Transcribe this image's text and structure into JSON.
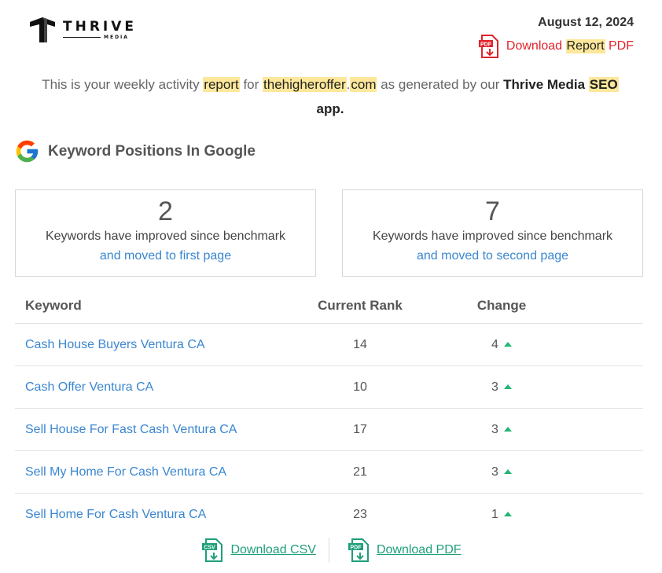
{
  "brand": {
    "name": "THRIVE",
    "sub": "MEDIA"
  },
  "header": {
    "date": "August 12, 2024",
    "download_report": {
      "prefix": "Download ",
      "highlight": "Report",
      "suffix": " PDF"
    }
  },
  "intro": {
    "t1": "This is your weekly activity ",
    "h1": "report",
    "t2": " for ",
    "h2a": "thehigheroffer",
    "dot": ".",
    "h2b": "com",
    "t3": " as generated by our ",
    "b1": "Thrive Media ",
    "h3": "SEO",
    "b2": "app."
  },
  "section": {
    "title": "Keyword Positions In Google"
  },
  "cards": [
    {
      "count": "2",
      "line1": "Keywords have improved since benchmark",
      "line2": "and moved to first page"
    },
    {
      "count": "7",
      "line1": "Keywords have improved since benchmark",
      "line2": "and moved to second page"
    }
  ],
  "table": {
    "headers": {
      "keyword": "Keyword",
      "rank": "Current Rank",
      "change": "Change"
    },
    "rows": [
      {
        "keyword": "Cash House Buyers Ventura CA",
        "rank": "14",
        "change": "4"
      },
      {
        "keyword": "Cash Offer Ventura CA",
        "rank": "10",
        "change": "3"
      },
      {
        "keyword": "Sell House For Fast Cash Ventura CA",
        "rank": "17",
        "change": "3"
      },
      {
        "keyword": "Sell My Home For Cash Ventura CA",
        "rank": "21",
        "change": "3"
      },
      {
        "keyword": "Sell Home For Cash Ventura CA",
        "rank": "23",
        "change": "1"
      }
    ]
  },
  "footer": {
    "csv_label": "Download CSV",
    "pdf_label": "Download PDF",
    "csv_badge": "CSV",
    "pdf_badge": "PDF"
  },
  "colors": {
    "link": "#3a86d0",
    "highlight": "#fde79a",
    "pdf_red": "#e0232b",
    "footer_green": "#1e9f7a",
    "arrow_up": "#22b573"
  },
  "icons": {
    "logo": "thrive-logo-icon",
    "google": "google-g-icon",
    "pdf": "pdf-file-icon",
    "csv": "csv-file-icon",
    "up": "arrow-up-icon"
  }
}
